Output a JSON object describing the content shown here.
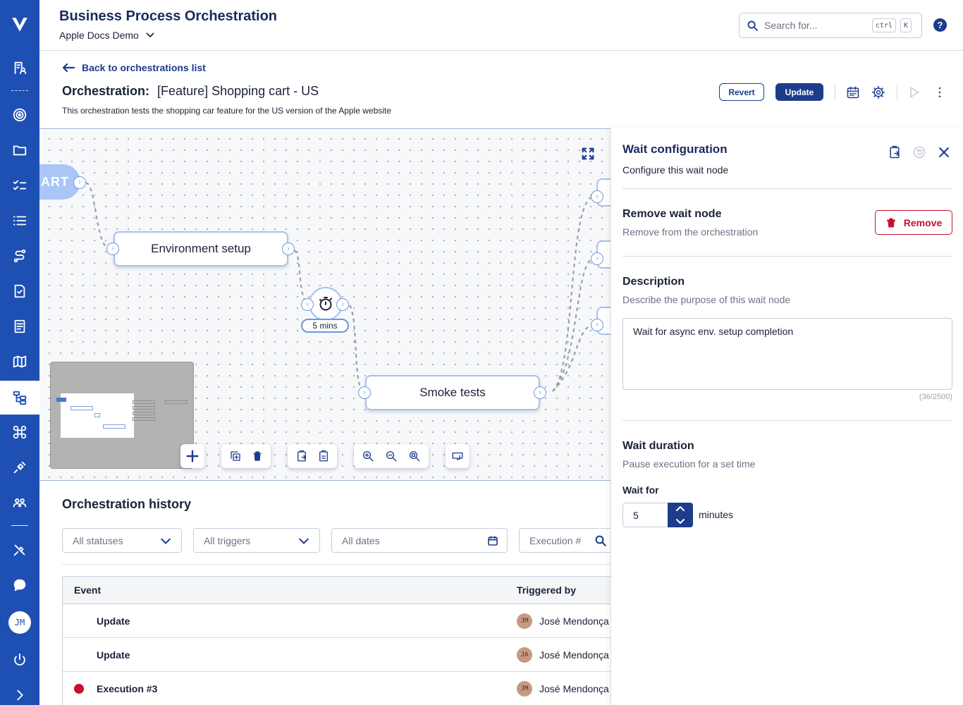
{
  "header": {
    "app_title": "Business Process Orchestration",
    "project": "Apple Docs Demo",
    "search_placeholder": "Search for...",
    "shortcut_ctrl": "ctrl",
    "shortcut_k": "K",
    "help_glyph": "?"
  },
  "sidebar": {
    "avatar": "JM",
    "icons": [
      "logo-icon",
      "documents-person-icon",
      "target-icon",
      "folder-icon",
      "checklist-icon",
      "list-icon",
      "route-icon",
      "file-report-icon",
      "form-icon",
      "map-icon",
      "orchestration-icon",
      "command-icon",
      "plug-icon",
      "users-icon",
      "satellite-icon",
      "chat-icon",
      "power-icon",
      "chevron-right-icon"
    ]
  },
  "page": {
    "back_label": "Back to orchestrations list",
    "title_prefix": "Orchestration:",
    "title_name": "[Feature] Shopping cart - US",
    "description": "This orchestration tests the shopping car feature for the US version of the Apple website",
    "revert_label": "Revert",
    "update_label": "Update"
  },
  "canvas": {
    "start_label": "ART",
    "node_env": "Environment setup",
    "node_smoke": "Smoke tests",
    "wait_label": "5 mins"
  },
  "history": {
    "title": "Orchestration history",
    "filter_status": "All statuses",
    "filter_trigger": "All triggers",
    "filter_dates": "All dates",
    "filter_execution": "Execution #",
    "col_event": "Event",
    "col_triggered": "Triggered by",
    "rows": [
      {
        "event": "Update",
        "initials": "JM",
        "user": "José Mendonça",
        "status": ""
      },
      {
        "event": "Update",
        "initials": "JA",
        "user": "José Mendonça",
        "status": ""
      },
      {
        "event": "Execution #3",
        "initials": "JM",
        "user": "José Mendonça",
        "status": "failed"
      }
    ]
  },
  "panel": {
    "title": "Wait configuration",
    "subtitle": "Configure this wait node",
    "remove_heading": "Remove wait node",
    "remove_sub": "Remove from the orchestration",
    "remove_button": "Remove",
    "desc_heading": "Description",
    "desc_sub": "Describe the purpose of this wait node",
    "desc_value": "Wait for async env. setup completion",
    "desc_counter": "(36/2500)",
    "duration_heading": "Wait duration",
    "duration_sub": "Pause execution for a set time",
    "wait_for_label": "Wait for",
    "wait_value": "5",
    "wait_unit": "minutes"
  },
  "colors": {
    "sidebar": "#1e50b4",
    "primary": "#1e3c8c",
    "danger": "#c8102e",
    "node_border": "#a6c1f0"
  }
}
